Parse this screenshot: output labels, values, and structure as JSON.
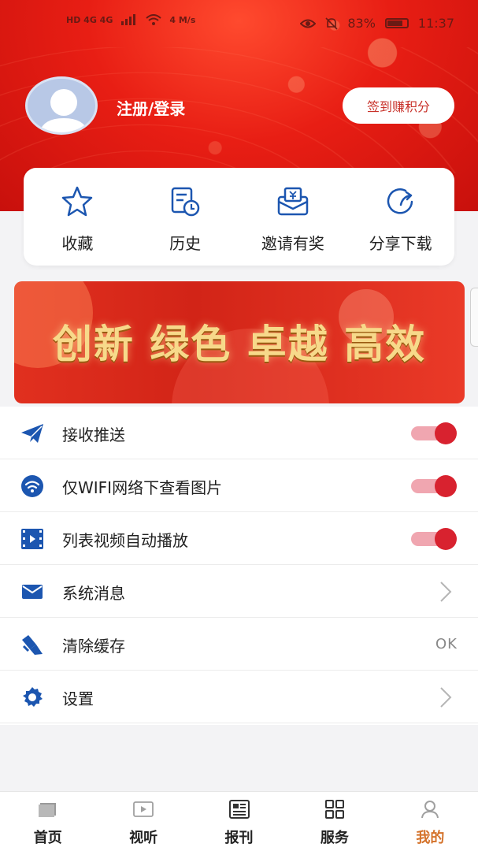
{
  "status_bar": {
    "network_left": "HD 4G 4G",
    "speed": "4 M/s",
    "battery": "83%",
    "time": "11:37"
  },
  "profile": {
    "login_label": "注册/登录",
    "signin_button": "签到赚积分"
  },
  "quick_actions": [
    {
      "label": "收藏",
      "icon": "star-icon"
    },
    {
      "label": "历史",
      "icon": "history-icon"
    },
    {
      "label": "邀请有奖",
      "icon": "invite-icon"
    },
    {
      "label": "分享下载",
      "icon": "share-icon"
    }
  ],
  "banner": {
    "text": "创新 绿色 卓越 高效"
  },
  "settings": [
    {
      "label": "接收推送",
      "icon": "paper-plane-icon",
      "control": "toggle",
      "on": true
    },
    {
      "label": "仅WIFI网络下查看图片",
      "icon": "wifi-icon",
      "control": "toggle",
      "on": true
    },
    {
      "label": "列表视频自动播放",
      "icon": "film-icon",
      "control": "toggle",
      "on": true
    },
    {
      "label": "系统消息",
      "icon": "envelope-icon",
      "control": "chevron"
    },
    {
      "label": "清除缓存",
      "icon": "broom-icon",
      "control": "text",
      "value": "OK"
    },
    {
      "label": "设置",
      "icon": "gear-icon",
      "control": "chevron"
    }
  ],
  "tabs": [
    {
      "label": "首页",
      "icon": "home-icon",
      "active": false
    },
    {
      "label": "视听",
      "icon": "video-icon",
      "active": false
    },
    {
      "label": "报刊",
      "icon": "newspaper-icon",
      "active": false
    },
    {
      "label": "服务",
      "icon": "grid-icon",
      "active": false
    },
    {
      "label": "我的",
      "icon": "user-icon",
      "active": true
    }
  ],
  "colors": {
    "accent_red": "#d8222f",
    "icon_blue": "#1c56b0",
    "active_tab": "#d4722a"
  }
}
